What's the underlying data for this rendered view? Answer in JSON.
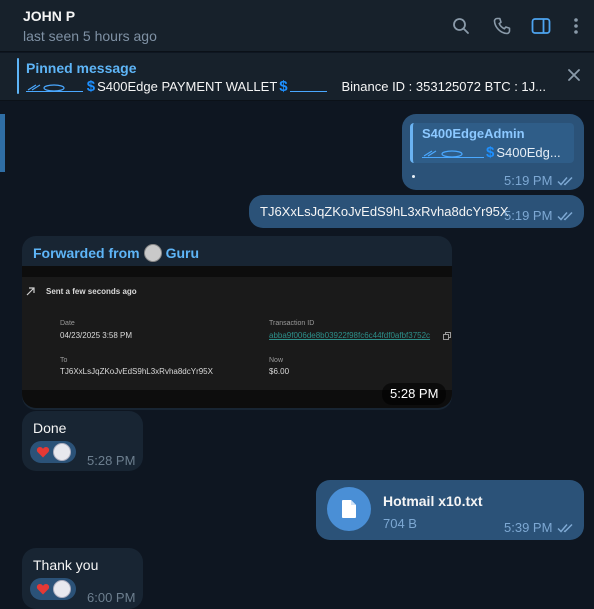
{
  "header": {
    "contact_name": "JOHN P",
    "status": "last seen 5 hours ago",
    "icons": [
      "search-icon",
      "phone-icon",
      "sidebar-toggle-icon",
      "more-vertical-icon"
    ]
  },
  "pinned": {
    "title": "Pinned message",
    "text_main": "S400Edge PAYMENT WALLET",
    "text_tail": "Binance ID : 353125072  BTC : 1J..."
  },
  "messages": {
    "reply_msg": {
      "reply_name": "S400EdgeAdmin",
      "reply_text": "S400Edg...",
      "time": "5:19 PM"
    },
    "address_msg": {
      "text": "TJ6XxLsJqZKoJvEdS9hL3xRvha8dcYr95X",
      "time": "5:19 PM"
    },
    "forwarded_msg": {
      "forwarded_label": "Forwarded from",
      "forwarded_name": "Guru",
      "time": "5:28 PM",
      "screenshot": {
        "sent_label": "Sent a few seconds ago",
        "date_label": "Date",
        "date_value": "04/23/2025 3:58 PM",
        "txid_label": "Transaction ID",
        "txid_value": "abba9f006de8b03922f98fc6c44fdf0afbf3752c",
        "to_label": "To",
        "to_value": "TJ6XxLsJqZKoJvEdS9hL3xRvha8dcYr95X",
        "now_label": "Now",
        "now_value": "$6.00"
      }
    },
    "done_msg": {
      "text": "Done",
      "time": "5:28 PM"
    },
    "file_msg": {
      "file_name": "Hotmail x10.txt",
      "file_size": "704 B",
      "time": "5:39 PM"
    },
    "thanks_msg": {
      "text": "Thank you",
      "time": "6:00 PM"
    }
  },
  "colors": {
    "background": "#0e1621",
    "outgoing_bubble": "#2b5278",
    "incoming_bubble": "#182533",
    "accent": "#5eb5f7"
  }
}
